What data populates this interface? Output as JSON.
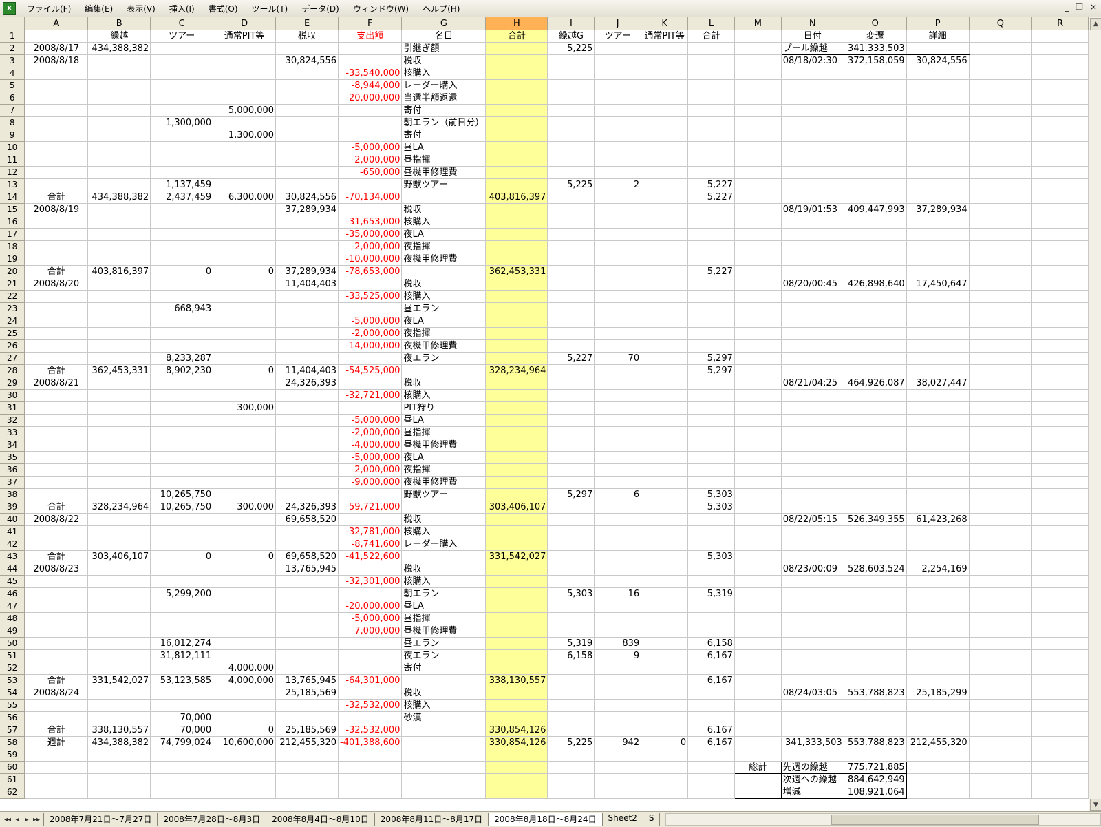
{
  "menu": [
    "ファイル(F)",
    "編集(E)",
    "表示(V)",
    "挿入(I)",
    "書式(O)",
    "ツール(T)",
    "データ(D)",
    "ウィンドウ(W)",
    "ヘルプ(H)"
  ],
  "window_controls": [
    "_",
    "❐",
    "×"
  ],
  "columns": [
    "A",
    "B",
    "C",
    "D",
    "E",
    "F",
    "G",
    "H",
    "I",
    "J",
    "K",
    "L",
    "M",
    "N",
    "O",
    "P",
    "Q",
    "R"
  ],
  "active_column": "H",
  "rows": [
    {
      "n": 1,
      "c": {
        "B": "繰越",
        "C": "ツアー",
        "D": "通常PIT等",
        "E": "税収",
        "F": "支出額",
        "G": "名目",
        "H": "合計",
        "I": "繰越G",
        "J": "ツアー",
        "K": "通常PIT等",
        "L": "合計",
        "N": "日付",
        "O": "変遷",
        "P": "詳細"
      }
    },
    {
      "n": 2,
      "c": {
        "A": "2008/8/17",
        "B": "434,388,382",
        "G": "引継ぎ額",
        "I": "5,225",
        "N": "プール繰越",
        "O": "341,333,503"
      }
    },
    {
      "n": 3,
      "c": {
        "A": "2008/8/18",
        "E": "30,824,556",
        "G": "税収",
        "N": "08/18/02:30",
        "O": "372,158,059",
        "P": "30,824,556"
      }
    },
    {
      "n": 4,
      "c": {
        "F": "-33,540,000",
        "G": "核購入"
      }
    },
    {
      "n": 5,
      "c": {
        "F": "-8,944,000",
        "G": "レーダー購入"
      }
    },
    {
      "n": 6,
      "c": {
        "F": "-20,000,000",
        "G": "当選半額返還"
      }
    },
    {
      "n": 7,
      "c": {
        "D": "5,000,000",
        "G": "寄付"
      }
    },
    {
      "n": 8,
      "c": {
        "C": "1,300,000",
        "G": "朝エラン（前日分）"
      }
    },
    {
      "n": 9,
      "c": {
        "D": "1,300,000",
        "G": "寄付"
      }
    },
    {
      "n": 10,
      "c": {
        "F": "-5,000,000",
        "G": "昼LA"
      }
    },
    {
      "n": 11,
      "c": {
        "F": "-2,000,000",
        "G": "昼指揮"
      }
    },
    {
      "n": 12,
      "c": {
        "F": "-650,000",
        "G": "昼機甲修理費"
      }
    },
    {
      "n": 13,
      "c": {
        "C": "1,137,459",
        "G": "野獣ツアー",
        "I": "5,225",
        "J": "2",
        "L": "5,227"
      }
    },
    {
      "n": 14,
      "sum": true,
      "c": {
        "A": "合計",
        "B": "434,388,382",
        "C": "2,437,459",
        "D": "6,300,000",
        "E": "30,824,556",
        "F": "-70,134,000",
        "H": "403,816,397",
        "L": "5,227"
      }
    },
    {
      "n": 15,
      "c": {
        "A": "2008/8/19",
        "E": "37,289,934",
        "G": "税収",
        "N": "08/19/01:53",
        "O": "409,447,993",
        "P": "37,289,934"
      }
    },
    {
      "n": 16,
      "c": {
        "F": "-31,653,000",
        "G": "核購入"
      }
    },
    {
      "n": 17,
      "c": {
        "F": "-35,000,000",
        "G": "夜LA"
      }
    },
    {
      "n": 18,
      "c": {
        "F": "-2,000,000",
        "G": "夜指揮"
      }
    },
    {
      "n": 19,
      "c": {
        "F": "-10,000,000",
        "G": "夜機甲修理費"
      }
    },
    {
      "n": 20,
      "sum": true,
      "c": {
        "A": "合計",
        "B": "403,816,397",
        "C": "0",
        "D": "0",
        "E": "37,289,934",
        "F": "-78,653,000",
        "H": "362,453,331",
        "L": "5,227"
      }
    },
    {
      "n": 21,
      "c": {
        "A": "2008/8/20",
        "E": "11,404,403",
        "G": "税収",
        "N": "08/20/00:45",
        "O": "426,898,640",
        "P": "17,450,647"
      }
    },
    {
      "n": 22,
      "c": {
        "F": "-33,525,000",
        "G": "核購入"
      }
    },
    {
      "n": 23,
      "c": {
        "C": "668,943",
        "G": "昼エラン"
      }
    },
    {
      "n": 24,
      "c": {
        "F": "-5,000,000",
        "G": "夜LA"
      }
    },
    {
      "n": 25,
      "c": {
        "F": "-2,000,000",
        "G": "夜指揮"
      }
    },
    {
      "n": 26,
      "c": {
        "F": "-14,000,000",
        "G": "夜機甲修理費"
      }
    },
    {
      "n": 27,
      "c": {
        "C": "8,233,287",
        "G": "夜エラン",
        "I": "5,227",
        "J": "70",
        "L": "5,297"
      }
    },
    {
      "n": 28,
      "sum": true,
      "c": {
        "A": "合計",
        "B": "362,453,331",
        "C": "8,902,230",
        "D": "0",
        "E": "11,404,403",
        "F": "-54,525,000",
        "H": "328,234,964",
        "L": "5,297"
      }
    },
    {
      "n": 29,
      "c": {
        "A": "2008/8/21",
        "E": "24,326,393",
        "G": "税収",
        "N": "08/21/04:25",
        "O": "464,926,087",
        "P": "38,027,447"
      }
    },
    {
      "n": 30,
      "c": {
        "F": "-32,721,000",
        "G": "核購入"
      }
    },
    {
      "n": 31,
      "c": {
        "D": "300,000",
        "G": "PIT狩り"
      }
    },
    {
      "n": 32,
      "c": {
        "F": "-5,000,000",
        "G": "昼LA"
      }
    },
    {
      "n": 33,
      "c": {
        "F": "-2,000,000",
        "G": "昼指揮"
      }
    },
    {
      "n": 34,
      "c": {
        "F": "-4,000,000",
        "G": "昼機甲修理費"
      }
    },
    {
      "n": 35,
      "c": {
        "F": "-5,000,000",
        "G": "夜LA"
      }
    },
    {
      "n": 36,
      "c": {
        "F": "-2,000,000",
        "G": "夜指揮"
      }
    },
    {
      "n": 37,
      "c": {
        "F": "-9,000,000",
        "G": "夜機甲修理費"
      }
    },
    {
      "n": 38,
      "c": {
        "C": "10,265,750",
        "G": "野獣ツアー",
        "I": "5,297",
        "J": "6",
        "L": "5,303"
      }
    },
    {
      "n": 39,
      "sum": true,
      "c": {
        "A": "合計",
        "B": "328,234,964",
        "C": "10,265,750",
        "D": "300,000",
        "E": "24,326,393",
        "F": "-59,721,000",
        "H": "303,406,107",
        "L": "5,303"
      }
    },
    {
      "n": 40,
      "c": {
        "A": "2008/8/22",
        "E": "69,658,520",
        "G": "税収",
        "N": "08/22/05:15",
        "O": "526,349,355",
        "P": "61,423,268"
      }
    },
    {
      "n": 41,
      "c": {
        "F": "-32,781,000",
        "G": "核購入"
      }
    },
    {
      "n": 42,
      "c": {
        "F": "-8,741,600",
        "G": "レーダー購入"
      }
    },
    {
      "n": 43,
      "sum": true,
      "c": {
        "A": "合計",
        "B": "303,406,107",
        "C": "0",
        "D": "0",
        "E": "69,658,520",
        "F": "-41,522,600",
        "H": "331,542,027",
        "L": "5,303"
      }
    },
    {
      "n": 44,
      "c": {
        "A": "2008/8/23",
        "E": "13,765,945",
        "G": "税収",
        "N": "08/23/00:09",
        "O": "528,603,524",
        "P": "2,254,169"
      }
    },
    {
      "n": 45,
      "c": {
        "F": "-32,301,000",
        "G": "核購入"
      }
    },
    {
      "n": 46,
      "c": {
        "C": "5,299,200",
        "G": "朝エラン",
        "I": "5,303",
        "J": "16",
        "L": "5,319"
      }
    },
    {
      "n": 47,
      "c": {
        "F": "-20,000,000",
        "G": "昼LA"
      }
    },
    {
      "n": 48,
      "c": {
        "F": "-5,000,000",
        "G": "昼指揮"
      }
    },
    {
      "n": 49,
      "c": {
        "F": "-7,000,000",
        "G": "昼機甲修理費"
      }
    },
    {
      "n": 50,
      "c": {
        "C": "16,012,274",
        "G": "昼エラン",
        "I": "5,319",
        "J": "839",
        "L": "6,158"
      }
    },
    {
      "n": 51,
      "c": {
        "C": "31,812,111",
        "G": "夜エラン",
        "I": "6,158",
        "J": "9",
        "L": "6,167"
      }
    },
    {
      "n": 52,
      "c": {
        "D": "4,000,000",
        "G": "寄付"
      }
    },
    {
      "n": 53,
      "sum": true,
      "c": {
        "A": "合計",
        "B": "331,542,027",
        "C": "53,123,585",
        "D": "4,000,000",
        "E": "13,765,945",
        "F": "-64,301,000",
        "H": "338,130,557",
        "L": "6,167"
      }
    },
    {
      "n": 54,
      "c": {
        "A": "2008/8/24",
        "E": "25,185,569",
        "G": "税収",
        "N": "08/24/03:05",
        "O": "553,788,823",
        "P": "25,185,299"
      }
    },
    {
      "n": 55,
      "c": {
        "F": "-32,532,000",
        "G": "核購入"
      }
    },
    {
      "n": 56,
      "c": {
        "C": "70,000",
        "G": "砂漠"
      }
    },
    {
      "n": 57,
      "sum": true,
      "c": {
        "A": "合計",
        "B": "338,130,557",
        "C": "70,000",
        "D": "0",
        "E": "25,185,569",
        "F": "-32,532,000",
        "H": "330,854,126",
        "L": "6,167"
      }
    },
    {
      "n": 58,
      "sum": true,
      "c": {
        "A": "週計",
        "B": "434,388,382",
        "C": "74,799,024",
        "D": "10,600,000",
        "E": "212,455,320",
        "F": "-401,388,600",
        "H": "330,854,126",
        "I": "5,225",
        "J": "942",
        "K": "0",
        "L": "6,167",
        "N": "341,333,503",
        "O": "553,788,823",
        "P": "212,455,320"
      }
    },
    {
      "n": 59,
      "c": {}
    },
    {
      "n": 60,
      "c": {
        "M": "総計",
        "N": "先週の繰越",
        "O": "775,721,885"
      }
    },
    {
      "n": 61,
      "c": {
        "N": "次週への繰越",
        "O": "884,642,949"
      }
    },
    {
      "n": 62,
      "c": {
        "N": "増減",
        "O": "108,921,064"
      }
    }
  ],
  "sheet_tabs": [
    "2008年7月21日～7月27日",
    "2008年7月28日～8月3日",
    "2008年8月4日～8月10日",
    "2008年8月11日～8月17日",
    "2008年8月18日～8月24日",
    "Sheet2",
    "S"
  ],
  "active_tab": "2008年8月18日～8月24日",
  "tab_nav": [
    "◂◂",
    "◂",
    "▸",
    "▸▸"
  ]
}
